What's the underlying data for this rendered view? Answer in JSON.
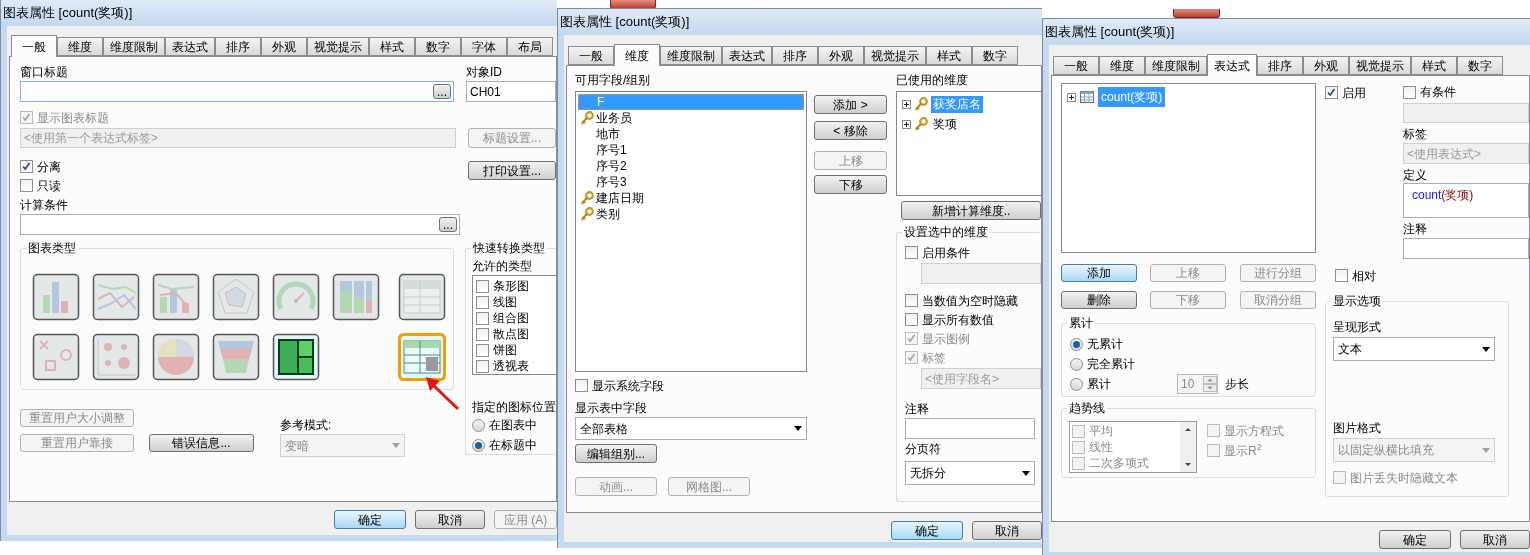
{
  "general_dialog": {
    "title": "图表属性 [count(奖项)]",
    "tabs": [
      {
        "label": "一般",
        "selected": true
      },
      {
        "label": "维度",
        "selected": false
      },
      {
        "label": "维度限制",
        "selected": false
      },
      {
        "label": "表达式",
        "selected": false
      },
      {
        "label": "排序",
        "selected": false
      },
      {
        "label": "外观",
        "selected": false
      },
      {
        "label": "视觉提示",
        "selected": false
      },
      {
        "label": "样式",
        "selected": false
      },
      {
        "label": "数字",
        "selected": false
      },
      {
        "label": "字体",
        "selected": false
      },
      {
        "label": "布局",
        "selected": false
      }
    ],
    "window_title_label": "窗口标题",
    "window_title_browse": {
      "label": "...",
      "disabled": false,
      "default": false
    },
    "object_id_label": "对象ID",
    "object_id_field": {
      "value": "CH01"
    },
    "show_title": {
      "label": "显示图表标题",
      "checked": true,
      "disabled": true
    },
    "title_field": {
      "placeholder": "<使用第一个表达式标签>",
      "disabled": true
    },
    "title_settings_button": {
      "label": "标题设置...",
      "disabled": true,
      "default": false
    },
    "detach": {
      "label": "分离",
      "checked": true,
      "disabled": false
    },
    "read_only": {
      "label": "只读",
      "checked": false,
      "disabled": false
    },
    "print_settings_button": {
      "label": "打印设置...",
      "disabled": false,
      "default": false
    },
    "calc_condition_label": "计算条件",
    "calc_condition_browse": {
      "label": "...",
      "disabled": false,
      "default": false
    },
    "chart_types": {
      "title": "图表类型",
      "charts": [
        {
          "kind": "bar",
          "enabled": false,
          "selected": false
        },
        {
          "kind": "line",
          "enabled": false,
          "selected": false
        },
        {
          "kind": "combo",
          "enabled": false,
          "selected": false
        },
        {
          "kind": "radar",
          "enabled": false,
          "selected": false
        },
        {
          "kind": "gauge",
          "enabled": false,
          "selected": false
        },
        {
          "kind": "mekko",
          "enabled": false,
          "selected": false
        },
        {
          "kind": "scatter",
          "enabled": false,
          "selected": false
        },
        {
          "kind": "grid",
          "enabled": false,
          "selected": false
        },
        {
          "kind": "pie",
          "enabled": false,
          "selected": false
        },
        {
          "kind": "funnel",
          "enabled": false,
          "selected": false
        },
        {
          "kind": "block",
          "enabled": true,
          "selected": false
        }
      ],
      "tables": [
        {
          "kind": "table",
          "enabled": false,
          "selected": false
        },
        {
          "kind": "pivot",
          "enabled": true,
          "selected": true
        }
      ]
    },
    "quick_change": {
      "title": "快速转换类型",
      "allowed_label": "允许的类型",
      "types": [
        {
          "label": "条形图",
          "checked": false
        },
        {
          "label": "线图",
          "checked": false
        },
        {
          "label": "组合图",
          "checked": false
        },
        {
          "label": "散点图",
          "checked": false
        },
        {
          "label": "饼图",
          "checked": false
        },
        {
          "label": "透视表",
          "checked": false
        }
      ],
      "icon_position_label": "指定的图标位置",
      "icon_positions": [
        {
          "label": "在图表中",
          "selected": false
        },
        {
          "label": "在标题中",
          "selected": true
        }
      ]
    },
    "reset_size_button": {
      "label": "重置用户大小调整",
      "disabled": true,
      "default": false
    },
    "reset_dock_button": {
      "label": "重置用户靠接",
      "disabled": true,
      "default": false
    },
    "error_info_button": {
      "label": "错误信息...",
      "disabled": false,
      "default": false
    },
    "reference_mode": {
      "label": "参考模式:",
      "value": "变暗",
      "disabled": true
    },
    "footer": [
      {
        "label": "确定",
        "disabled": false,
        "default": true
      },
      {
        "label": "取消",
        "disabled": false,
        "default": false
      },
      {
        "label": "应用 (A)",
        "disabled": true,
        "default": false
      }
    ]
  },
  "dimensions_dialog": {
    "title": "图表属性 [count(奖项)]",
    "tabs": [
      {
        "label": "一般",
        "selected": false
      },
      {
        "label": "维度",
        "selected": true
      },
      {
        "label": "维度限制",
        "selected": false
      },
      {
        "label": "表达式",
        "selected": false
      },
      {
        "label": "排序",
        "selected": false
      },
      {
        "label": "外观",
        "selected": false
      },
      {
        "label": "视觉提示",
        "selected": false
      },
      {
        "label": "样式",
        "selected": false
      },
      {
        "label": "数字",
        "selected": false
      }
    ],
    "available_label": "可用字段/组别",
    "fields": [
      {
        "label": "F",
        "kind": "field",
        "selected": true
      },
      {
        "label": "业务员",
        "kind": "key",
        "selected": false
      },
      {
        "label": "地市",
        "kind": "field",
        "selected": false
      },
      {
        "label": "序号1",
        "kind": "field",
        "selected": false
      },
      {
        "label": "序号2",
        "kind": "field",
        "selected": false
      },
      {
        "label": "序号3",
        "kind": "field",
        "selected": false
      },
      {
        "label": "建店日期",
        "kind": "key",
        "selected": false
      },
      {
        "label": "类别",
        "kind": "key",
        "selected": false
      }
    ],
    "move_buttons": [
      {
        "label": "添加 >",
        "disabled": false,
        "default": false
      },
      {
        "label": "< 移除",
        "disabled": false,
        "default": false
      },
      {
        "label": "上移",
        "disabled": true,
        "default": false
      },
      {
        "label": "下移",
        "disabled": false,
        "default": false
      }
    ],
    "used_label": "已使用的维度",
    "used": [
      {
        "label": "获奖店名",
        "selected": true
      },
      {
        "label": "奖项",
        "selected": false
      }
    ],
    "new_calc_button": {
      "label": "新增计算维度..",
      "disabled": false,
      "default": false
    },
    "selected_dimension": {
      "title": "设置选中的维度",
      "enable_condition": {
        "label": "启用条件",
        "checked": false,
        "disabled": false
      },
      "condition_field": {
        "disabled": true
      },
      "options": [
        {
          "label": "当数值为空时隐藏",
          "checked": false,
          "disabled": false
        },
        {
          "label": "显示所有数值",
          "checked": false,
          "disabled": false
        },
        {
          "label": "显示图例",
          "checked": true,
          "disabled": true
        },
        {
          "label": "标签",
          "checked": true,
          "disabled": true
        }
      ],
      "label_field": {
        "placeholder": "<使用字段名>",
        "disabled": true
      },
      "comment_label": "注释",
      "page_break_label": "分页符",
      "page_break": {
        "value": "无拆分",
        "disabled": false
      }
    },
    "show_system_fields": {
      "label": "显示系统字段",
      "checked": false,
      "disabled": false
    },
    "table_fields_label": "显示表中字段",
    "table_fields": {
      "value": "全部表格",
      "disabled": false
    },
    "edit_groups_button": {
      "label": "编辑组别...",
      "disabled": false,
      "default": false
    },
    "animation_button": {
      "label": "动画...",
      "disabled": true,
      "default": false
    },
    "trellis_button": {
      "label": "网格图...",
      "disabled": true,
      "default": false
    },
    "footer": [
      {
        "label": "确定",
        "disabled": false,
        "default": true
      },
      {
        "label": "取消",
        "disabled": false,
        "default": false
      }
    ]
  },
  "expressions_dialog": {
    "title": "图表属性 [count(奖项)]",
    "tabs": [
      {
        "label": "一般",
        "selected": false
      },
      {
        "label": "维度",
        "selected": false
      },
      {
        "label": "维度限制",
        "selected": false
      },
      {
        "label": "表达式",
        "selected": true
      },
      {
        "label": "排序",
        "selected": false
      },
      {
        "label": "外观",
        "selected": false
      },
      {
        "label": "视觉提示",
        "selected": false
      },
      {
        "label": "样式",
        "selected": false
      },
      {
        "label": "数字",
        "selected": false
      }
    ],
    "expressions": [
      {
        "label": "count(奖项)",
        "selected": true
      }
    ],
    "enable": {
      "label": "启用",
      "checked": true,
      "disabled": false
    },
    "conditional": {
      "label": "有条件",
      "checked": false,
      "disabled": false
    },
    "condition_field": {
      "disabled": true
    },
    "label_label": "标签",
    "label_field": {
      "placeholder": "<使用表达式>",
      "disabled": true
    },
    "definition_label": "定义",
    "definition": {
      "function": "count",
      "argument": "(奖项)"
    },
    "comment_label": "注释",
    "buttons": [
      {
        "label": "添加",
        "disabled": false,
        "default": true
      },
      {
        "label": "上移",
        "disabled": true,
        "default": false
      },
      {
        "label": "进行分组",
        "disabled": true,
        "default": false
      },
      {
        "label": "删除",
        "disabled": false,
        "default": false
      },
      {
        "label": "下移",
        "disabled": true,
        "default": false
      },
      {
        "label": "取消分组",
        "disabled": true,
        "default": false
      }
    ],
    "relative": {
      "label": "相对",
      "checked": false,
      "disabled": false
    },
    "accumulation": {
      "title": "累计",
      "options": [
        {
          "label": "无累计",
          "selected": true
        },
        {
          "label": "完全累计",
          "selected": false
        },
        {
          "label": "累计",
          "selected": false
        }
      ],
      "steps": {
        "value": "10",
        "disabled": true
      },
      "steps_label": "步长"
    },
    "trendlines": {
      "title": "趋势线",
      "items": [
        {
          "label": "平均",
          "checked": false,
          "disabled": true
        },
        {
          "label": "线性",
          "checked": false,
          "disabled": true
        },
        {
          "label": "二次多项式",
          "checked": false,
          "disabled": true
        }
      ],
      "show_equation": {
        "label": "显示方程式",
        "checked": false,
        "disabled": true
      },
      "show_r2": {
        "label": "显示R$^{2}$",
        "checked": false,
        "disabled": true
      }
    },
    "display_options": {
      "title": "显示选项",
      "representation_label": "呈现形式",
      "representation": {
        "value": "文本",
        "disabled": false
      },
      "image_format_label": "图片格式",
      "image_format": {
        "value": "以固定纵横比填充",
        "disabled": true
      },
      "hide_text": {
        "label": "图片丢失时隐藏文本",
        "checked": false,
        "disabled": true
      }
    },
    "footer": [
      {
        "label": "确定",
        "disabled": false,
        "default": false
      },
      {
        "label": "取消",
        "disabled": false,
        "default": false
      }
    ]
  }
}
